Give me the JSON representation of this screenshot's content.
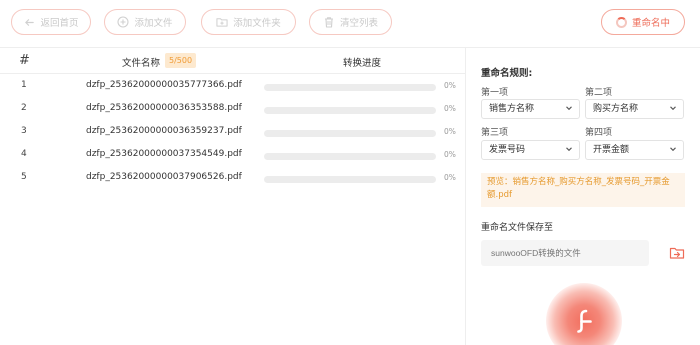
{
  "toolbar": {
    "back_label": "返回首页",
    "add_file_label": "添加文件",
    "add_folder_label": "添加文件夹",
    "clear_label": "清空列表",
    "rename_label": "重命名中"
  },
  "list": {
    "col_hash": "#",
    "col_name": "文件名称",
    "count_badge": "5/500",
    "col_progress": "转换进度",
    "rows": [
      {
        "num": "1",
        "name": "dzfp_25362000000035777366.pdf",
        "progress": 0,
        "pct": "0%"
      },
      {
        "num": "2",
        "name": "dzfp_25362000000036353588.pdf",
        "progress": 0,
        "pct": "0%"
      },
      {
        "num": "3",
        "name": "dzfp_25362000000036359237.pdf",
        "progress": 0,
        "pct": "0%"
      },
      {
        "num": "4",
        "name": "dzfp_25362000000037354549.pdf",
        "progress": 0,
        "pct": "0%"
      },
      {
        "num": "5",
        "name": "dzfp_25362000000037906526.pdf",
        "progress": 0,
        "pct": "0%"
      }
    ]
  },
  "panel": {
    "title": "重命名规则:",
    "items": [
      {
        "label": "第一项",
        "value": "销售方名称"
      },
      {
        "label": "第二项",
        "value": "购买方名称"
      },
      {
        "label": "第三项",
        "value": "发票号码"
      },
      {
        "label": "第四项",
        "value": "开票金额"
      }
    ],
    "preview": "预览：销售方名称_购买方名称_发票号码_开票金额.pdf",
    "save_label": "重命名文件保存至",
    "save_placeholder": "sunwooOFD转换的文件"
  },
  "colors": {
    "accent": "#ee6b57",
    "accent_border": "#f6c9c2",
    "badge_bg": "#fde9cf",
    "badge_text": "#f09b35",
    "preview_bg": "#fdf4ea",
    "preview_text": "#e69a2e"
  },
  "icons": {
    "back": "arrow-left-icon",
    "add_file": "plus-circle-icon",
    "add_folder": "folder-plus-icon",
    "clear": "trash-icon",
    "rename": "spinner-icon",
    "chevron": "chevron-down-icon",
    "save_folder": "folder-open-icon",
    "logo": "app-logo-icon"
  }
}
